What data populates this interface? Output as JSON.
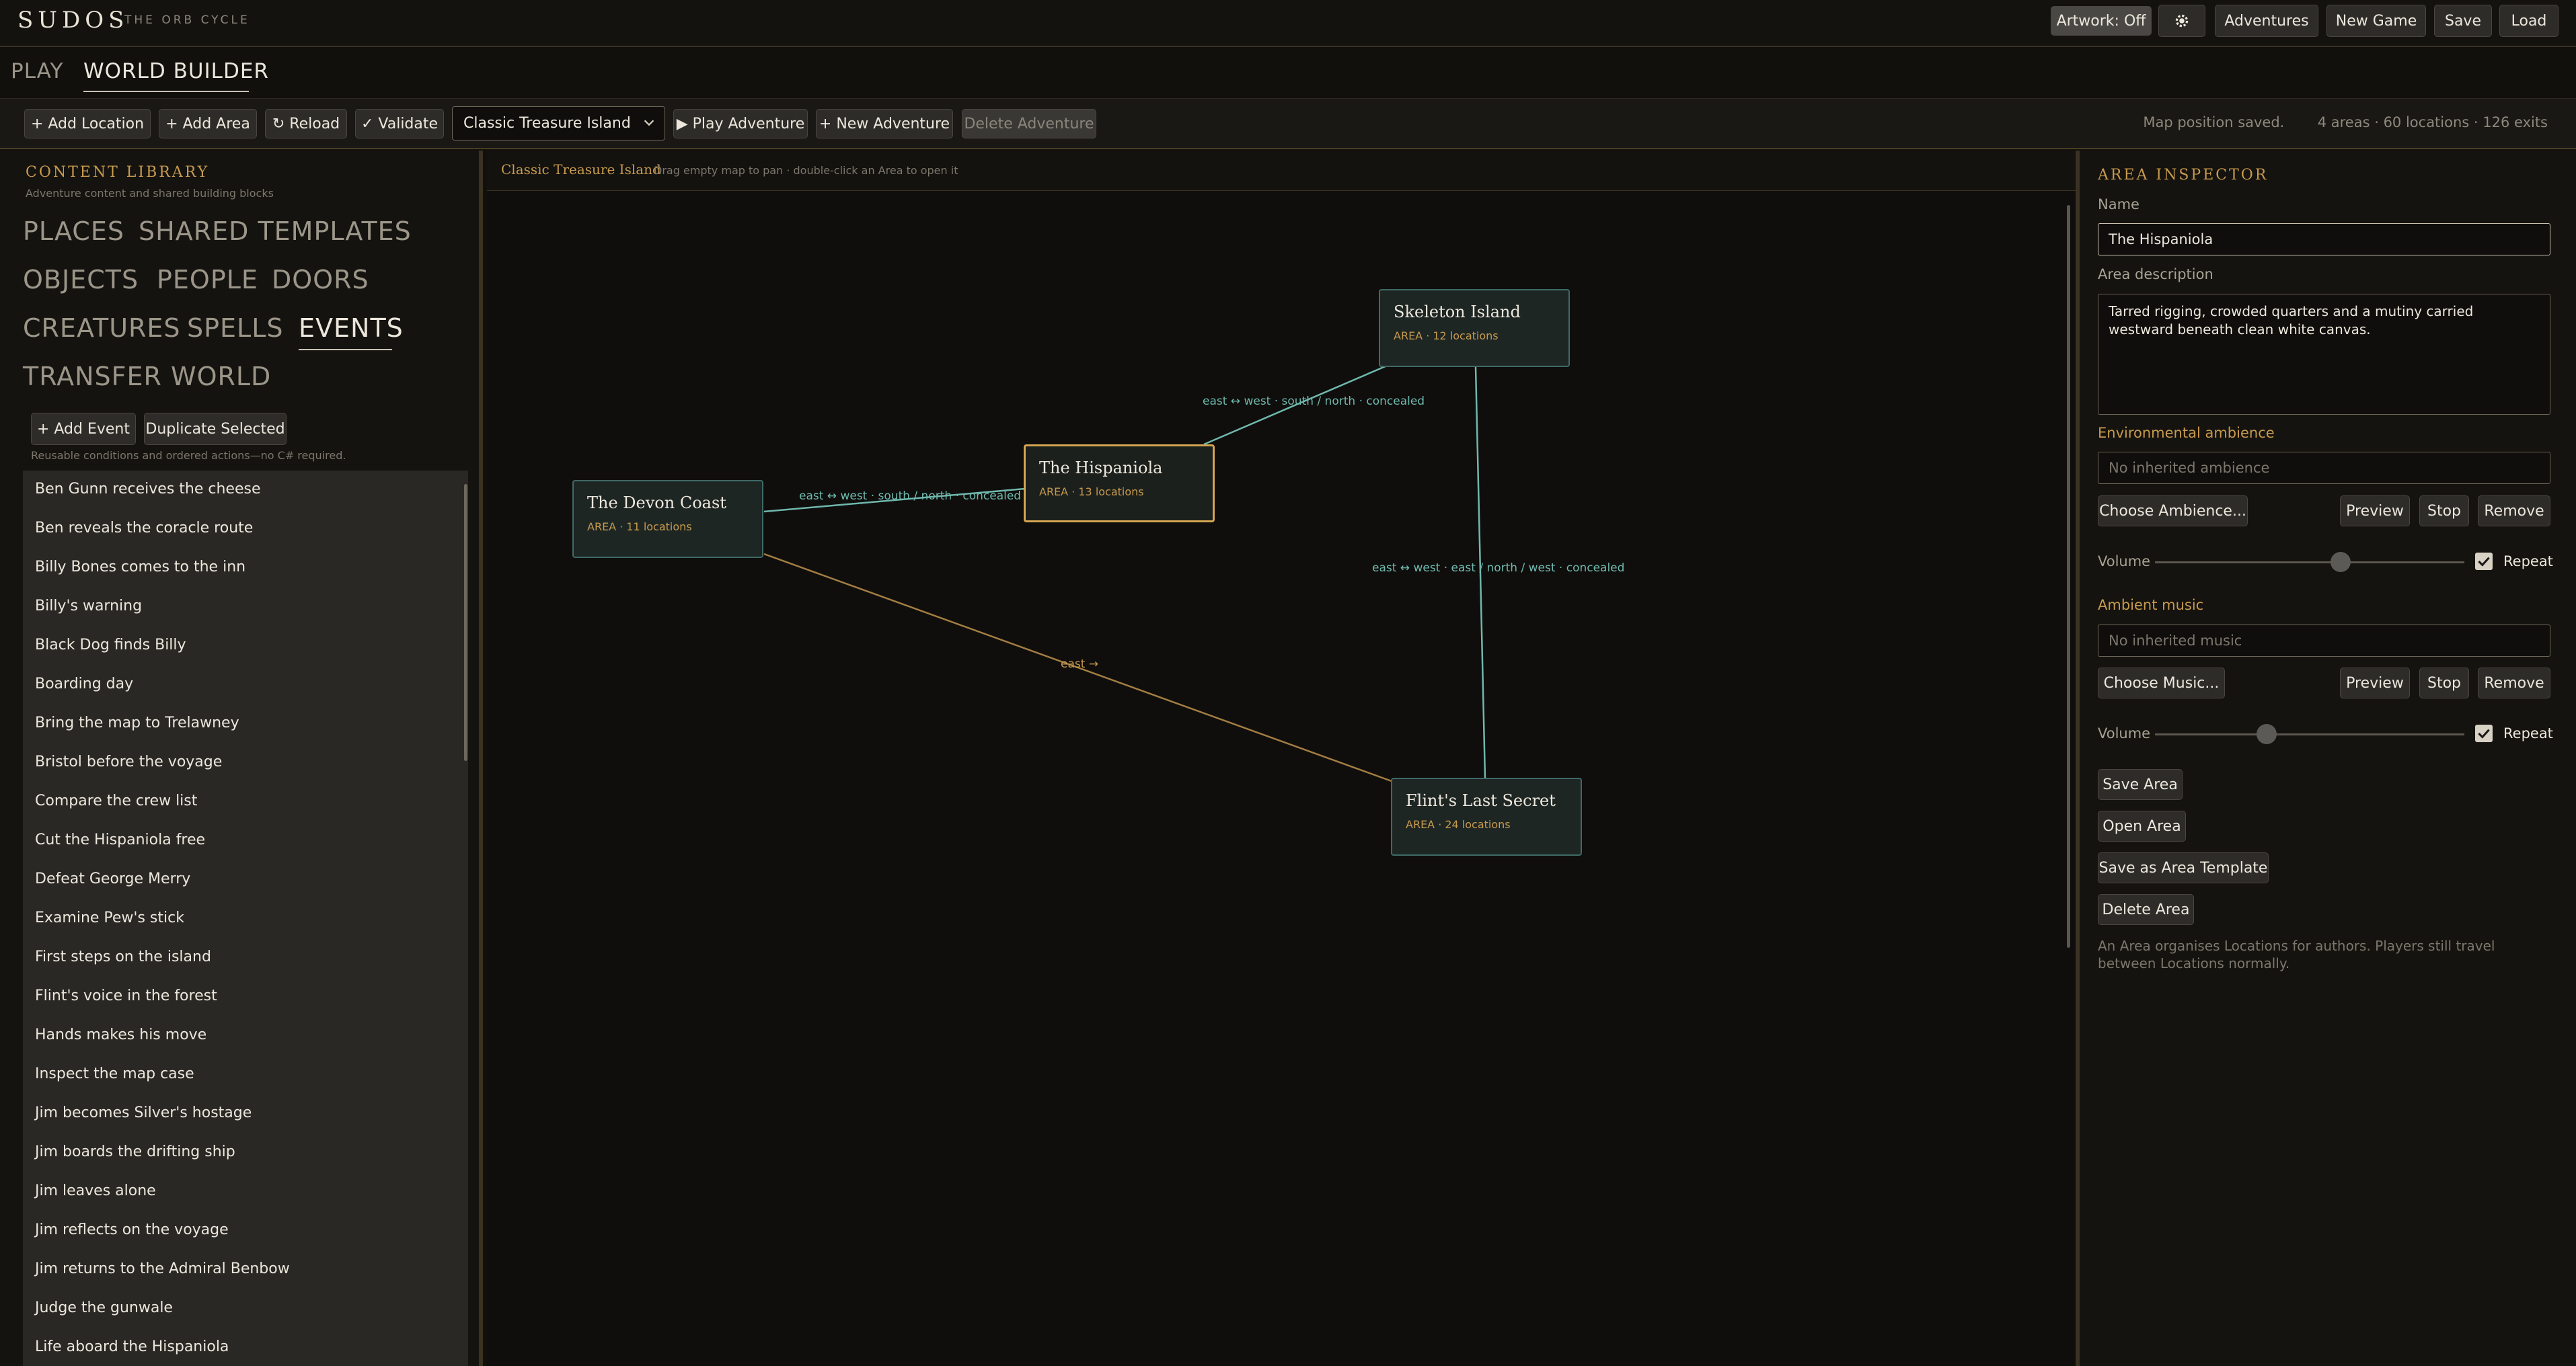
{
  "app": {
    "title": "SUDOS",
    "subtitle": "THE ORB CYCLE"
  },
  "top_buttons": {
    "artwork": "Artwork: Off",
    "adventures": "Adventures",
    "new_game": "New Game",
    "save": "Save",
    "load": "Load"
  },
  "main_tabs": [
    {
      "label": "PLAY",
      "active": false
    },
    {
      "label": "WORLD BUILDER",
      "active": true
    }
  ],
  "toolbar": {
    "add_location": "+ Add Location",
    "add_area": "+ Add Area",
    "reload": "↻ Reload",
    "validate": "✓ Validate",
    "adventure_select": "Classic Treasure Island",
    "play_adventure": "▶ Play Adventure",
    "new_adventure": "+ New Adventure",
    "delete_adventure": "Delete Adventure",
    "status_saved": "Map position saved.",
    "status_counts": "4 areas · 60 locations · 126 exits"
  },
  "library": {
    "title": "CONTENT LIBRARY",
    "subtitle": "Adventure content and shared building blocks",
    "categories": [
      "PLACES",
      "SHARED TEMPLATES",
      "OBJECTS",
      "PEOPLE",
      "DOORS",
      "CREATURES",
      "SPELLS",
      "EVENTS",
      "TRANSFER",
      "WORLD"
    ],
    "active_category": "EVENTS",
    "add_event": "+ Add Event",
    "duplicate": "Duplicate Selected",
    "hint": "Reusable conditions and ordered actions—no C# required.",
    "events": [
      "Ben Gunn receives the cheese",
      "Ben reveals the coracle route",
      "Billy Bones comes to the inn",
      "Billy's warning",
      "Black Dog finds Billy",
      "Boarding day",
      "Bring the map to Trelawney",
      "Bristol before the voyage",
      "Compare the crew list",
      "Cut the Hispaniola free",
      "Defeat George Merry",
      "Examine Pew's stick",
      "First steps on the island",
      "Flint's voice in the forest",
      "Hands makes his move",
      "Inspect the map case",
      "Jim becomes Silver's hostage",
      "Jim boards the drifting ship",
      "Jim leaves alone",
      "Jim reflects on the voyage",
      "Jim returns to the Admiral Benbow",
      "Judge the gunwale",
      "Life aboard the Hispaniola"
    ]
  },
  "map": {
    "title": "Classic Treasure Island",
    "hint": "Drag empty map to pan · double-click an Area to open it",
    "areas": [
      {
        "name": "Skeleton Island",
        "meta": "AREA · 12 locations"
      },
      {
        "name": "The Hispaniola",
        "meta": "AREA · 13 locations"
      },
      {
        "name": "The Devon Coast",
        "meta": "AREA · 11 locations"
      },
      {
        "name": "Flint's Last Secret",
        "meta": "AREA · 24 locations"
      }
    ],
    "edges": [
      {
        "label": "east ↔ west · south / north · concealed",
        "color": "#6fb8ad"
      },
      {
        "label": "east ↔ west · south / north · concealed",
        "color": "#6fb8ad"
      },
      {
        "label": "east ↔ west · east / north / west · concealed",
        "color": "#6fb8ad"
      },
      {
        "label": "east →",
        "color": "#c79a4e"
      }
    ]
  },
  "inspector": {
    "title": "AREA INSPECTOR",
    "name_label": "Name",
    "name_value": "The Hispaniola",
    "desc_label": "Area description",
    "desc_value": "Tarred rigging, crowded quarters and a mutiny carried westward beneath clean white canvas.",
    "ambience_label": "Environmental ambience",
    "ambience_placeholder": "No inherited ambience",
    "choose_ambience": "Choose Ambience...",
    "preview": "Preview",
    "stop": "Stop",
    "remove": "Remove",
    "volume_label": "Volume",
    "ambience_volume": 0.6,
    "repeat_label": "Repeat",
    "music_label": "Ambient music",
    "music_placeholder": "No inherited music",
    "choose_music": "Choose Music...",
    "music_volume": 0.36,
    "save_area": "Save Area",
    "open_area": "Open Area",
    "save_template": "Save as Area Template",
    "delete_area": "Delete Area",
    "footnote": "An Area organises Locations for authors. Players still travel between Locations normally."
  },
  "colors": {
    "accent": "#c79a4e",
    "teal": "#6fb8ad",
    "selected": "#d4a551"
  }
}
